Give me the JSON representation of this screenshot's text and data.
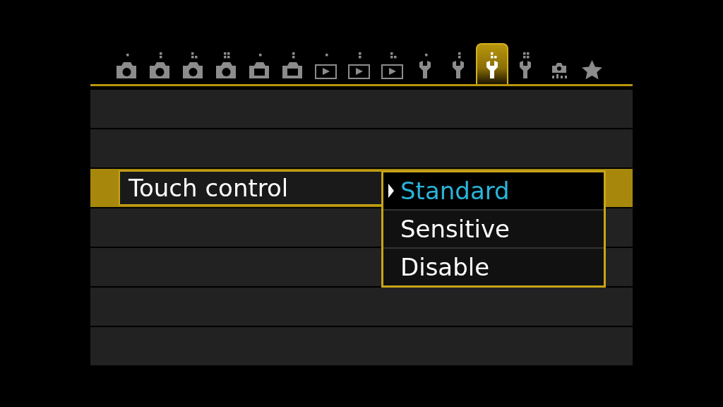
{
  "tabs": [
    {
      "kind": "camera",
      "selected": false
    },
    {
      "kind": "camera",
      "selected": false
    },
    {
      "kind": "camera",
      "selected": false
    },
    {
      "kind": "camera",
      "selected": false
    },
    {
      "kind": "camera-screen",
      "selected": false
    },
    {
      "kind": "camera-screen",
      "selected": false
    },
    {
      "kind": "play",
      "selected": false
    },
    {
      "kind": "play",
      "selected": false
    },
    {
      "kind": "play",
      "selected": false
    },
    {
      "kind": "wrench",
      "selected": false
    },
    {
      "kind": "wrench",
      "selected": false
    },
    {
      "kind": "wrench",
      "selected": true
    },
    {
      "kind": "wrench",
      "selected": false
    },
    {
      "kind": "custom",
      "selected": false
    },
    {
      "kind": "star",
      "selected": false
    }
  ],
  "rows": [
    {
      "selected": false
    },
    {
      "selected": false
    },
    {
      "label": "Touch control",
      "selected": true
    },
    {
      "selected": false
    },
    {
      "selected": false
    },
    {
      "selected": false
    },
    {
      "selected": false
    }
  ],
  "dropdown": {
    "options": [
      {
        "label": "Standard",
        "selected": true
      },
      {
        "label": "Sensitive",
        "selected": false
      },
      {
        "label": "Disable",
        "selected": false
      }
    ]
  }
}
